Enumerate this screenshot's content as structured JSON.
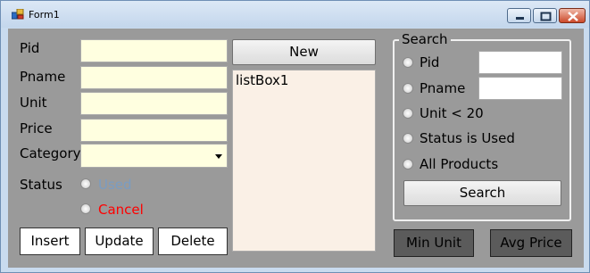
{
  "window": {
    "title": "Form1"
  },
  "fields": {
    "pid_label": "Pid",
    "pname_label": "Pname",
    "unit_label": "Unit",
    "price_label": "Price",
    "category_label": "Category",
    "status_label": "Status"
  },
  "status": {
    "used_label": "Used",
    "cancel_label": "Cancel",
    "used_color": "#7a9cc2",
    "cancel_color": "#ff0000"
  },
  "buttons": {
    "insert": "Insert",
    "update": "Update",
    "delete": "Delete",
    "new": "New",
    "min_unit": "Min Unit",
    "avg_price": "Avg Price"
  },
  "listbox": {
    "items": [
      "listBox1"
    ]
  },
  "search": {
    "title": "Search",
    "pid": "Pid",
    "pname": "Pname",
    "unit_lt_20": "Unit < 20",
    "status_used": "Status is Used",
    "all_products": "All Products",
    "button": "Search"
  },
  "colors": {
    "form_background": "#9a9a9a",
    "input_background": "#ffffe0",
    "listbox_background": "#faf0e6"
  }
}
